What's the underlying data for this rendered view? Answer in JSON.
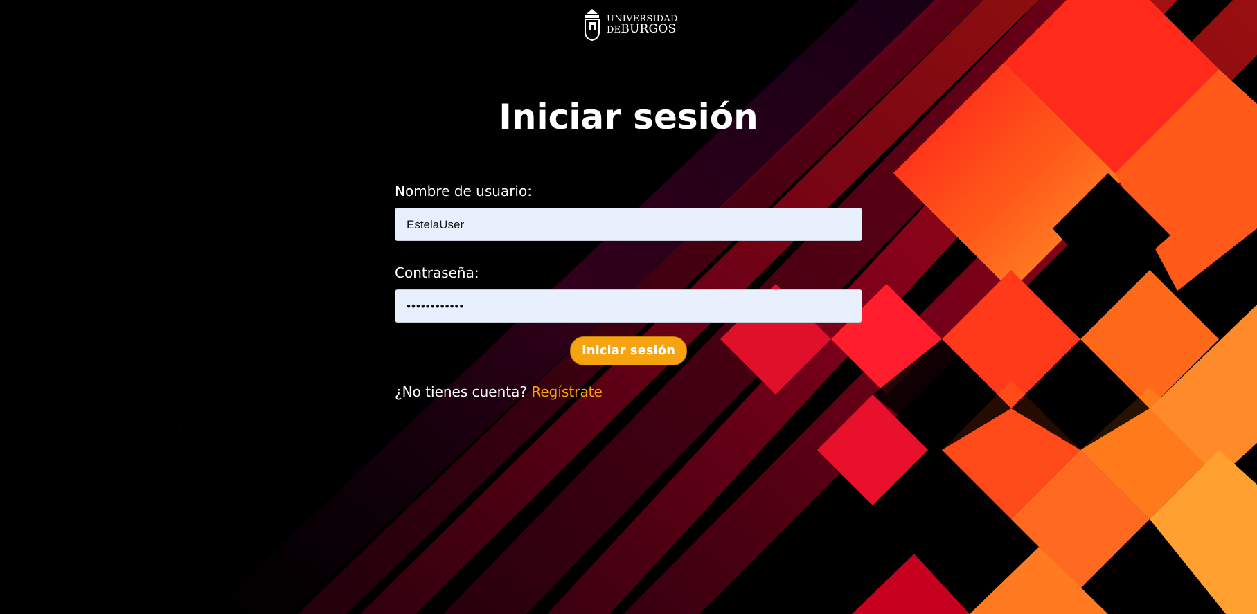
{
  "header": {
    "logo_line1": "UNIVERSIDAD",
    "logo_line2_prefix": "DE",
    "logo_line2_main": "BURGOS",
    "crest_icon": "university-crest-icon"
  },
  "main": {
    "title": "Iniciar sesión"
  },
  "form": {
    "username_label": "Nombre de usuario:",
    "username_value": "EstelaUser",
    "password_label": "Contraseña:",
    "password_masked": "••••••••••••",
    "submit_label": "Iniciar sesión",
    "signup_prompt": "¿No tienes cuenta?",
    "signup_link": "Regístrate"
  },
  "colors": {
    "background": "#000000",
    "accent": "#f5a30f",
    "input_bg": "#e8f0fe"
  }
}
